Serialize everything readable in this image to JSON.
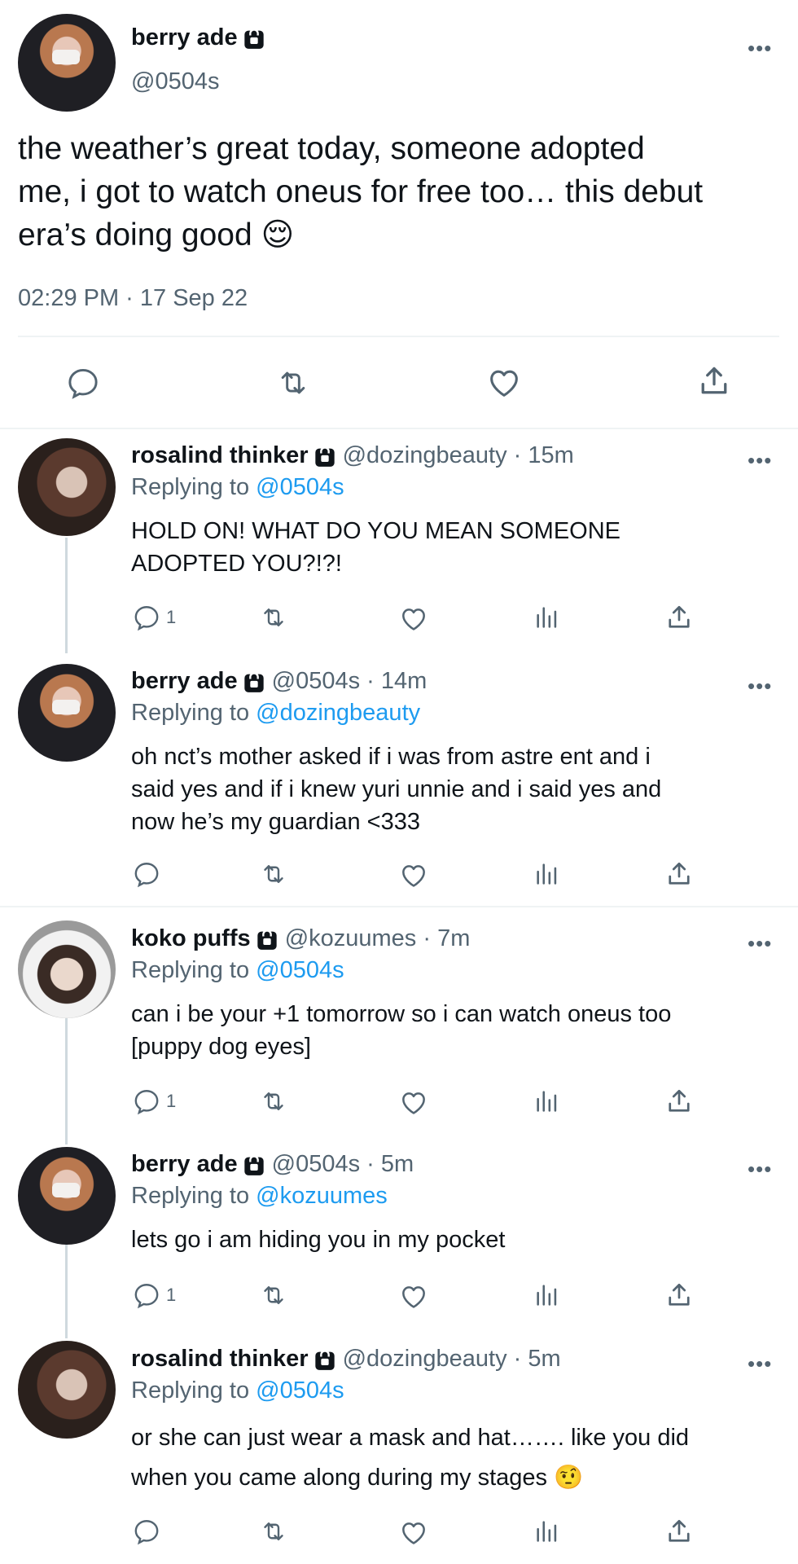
{
  "main_tweet": {
    "author_name": "berry ade",
    "handle": "@0504s",
    "text_line1": "the weather’s great today, someone adopted",
    "text_line2": "me, i got to watch oneus for free too… this debut",
    "text_line3": "era’s doing good",
    "emoji": "😌",
    "timestamp": "02:29 PM · 17 Sep 22",
    "more": "•••"
  },
  "replies": [
    {
      "author_name": "rosalind thinker",
      "meta": "@dozingbeauty · 15m",
      "replying_prefix": "Replying to",
      "replying_to": "@0504s",
      "lines": [
        "HOLD ON! WHAT DO YOU MEAN SOMEONE",
        "ADOPTED YOU?!?!"
      ],
      "reply_count": "1",
      "more": "•••"
    },
    {
      "author_name": "berry ade",
      "meta": "@0504s · 14m",
      "replying_prefix": "Replying to",
      "replying_to": "@dozingbeauty",
      "lines": [
        "oh nct’s mother asked if i was from astre ent and i",
        "said yes and if i knew yuri unnie and i said yes and",
        "now he’s my guardian <333"
      ],
      "reply_count": "",
      "more": "•••"
    },
    {
      "author_name": "koko puffs",
      "meta": "@kozuumes · 7m",
      "replying_prefix": "Replying to",
      "replying_to": "@0504s",
      "lines": [
        "can i be your +1 tomorrow so i can watch oneus too",
        "[puppy dog eyes]"
      ],
      "reply_count": "1",
      "more": "•••"
    },
    {
      "author_name": "berry ade",
      "meta": "@0504s · 5m",
      "replying_prefix": "Replying to",
      "replying_to": "@kozuumes",
      "lines": [
        "lets go i am hiding you in my pocket"
      ],
      "reply_count": "1",
      "more": "•••"
    },
    {
      "author_name": "rosalind thinker",
      "meta": "@dozingbeauty · 5m",
      "replying_prefix": "Replying to",
      "replying_to": "@0504s",
      "lines": [
        "or she can just wear a mask and hat……. like you did",
        "when you came along during my stages"
      ],
      "emoji": "🤨",
      "reply_count": "",
      "more": "•••"
    }
  ],
  "icons": {
    "reply": "reply-icon",
    "retweet": "retweet-icon",
    "like": "heart-icon",
    "views": "views-icon",
    "share": "share-icon",
    "lock": "lock-icon"
  },
  "colors": {
    "link": "#1d9bf0",
    "muted": "#536471",
    "text": "#0f1419"
  }
}
